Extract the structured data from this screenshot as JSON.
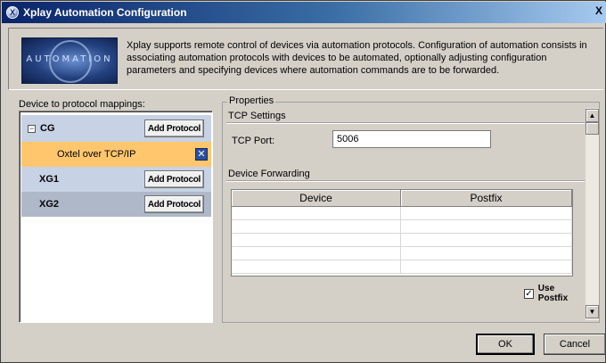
{
  "window": {
    "title": "Xplay Automation Configuration",
    "title_icon_glyph": "X",
    "close_glyph": "X"
  },
  "header": {
    "logo_text": "AUTOMATION",
    "description": "Xplay supports remote control of devices via automation protocols.  Configuration of automation consists in associating automation protocols with devices to be automated, optionally adjusting configuration parameters and specifying devices where automation commands are to be forwarded."
  },
  "mappings": {
    "label": "Device to protocol mappings:",
    "expander_glyph": "−",
    "remove_glyph": "✕",
    "add_protocol_label": "Add Protocol",
    "devices": [
      {
        "name": "CG",
        "protocol": "Oxtel over TCP/IP"
      },
      {
        "name": "XG1"
      },
      {
        "name": "XG2"
      }
    ]
  },
  "properties": {
    "legend": "Properties",
    "tcp_settings_label": "TCP Settings",
    "tcp_port_label": "TCP Port:",
    "tcp_port_value": "5006",
    "device_forwarding_label": "Device Forwarding",
    "columns": [
      "Device",
      "Postfix"
    ],
    "use_postfix_label": "Use Postfix",
    "use_postfix_checked": true,
    "check_glyph": "✓"
  },
  "scrollbar": {
    "up_glyph": "▲",
    "down_glyph": "▼"
  },
  "buttons": {
    "ok": "OK",
    "cancel": "Cancel"
  }
}
